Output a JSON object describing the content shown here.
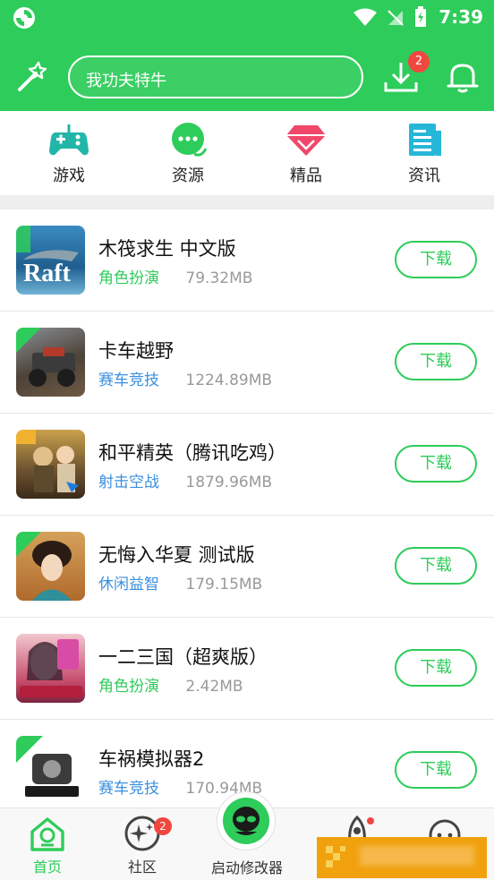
{
  "statusbar": {
    "time": "7:39"
  },
  "header": {
    "search_placeholder": "我功夫特牛",
    "download_badge": "2"
  },
  "categories": [
    {
      "label": "游戏",
      "icon": "gamepad-icon"
    },
    {
      "label": "资源",
      "icon": "chat-bubble-icon"
    },
    {
      "label": "精品",
      "icon": "diamond-icon"
    },
    {
      "label": "资讯",
      "icon": "news-icon"
    }
  ],
  "apps": [
    {
      "name": "木筏求生  中文版",
      "genre": "角色扮演",
      "genre_color": "#2ecc5a",
      "size": "79.32MB",
      "button": "下载"
    },
    {
      "name": "卡车越野",
      "genre": "赛车竞技",
      "genre_color": "#3a8fe0",
      "size": "1224.89MB",
      "button": "下载"
    },
    {
      "name": "和平精英（腾讯吃鸡）",
      "genre": "射击空战",
      "genre_color": "#3a8fe0",
      "size": "1879.96MB",
      "button": "下载"
    },
    {
      "name": "无悔入华夏  测试版",
      "genre": "休闲益智",
      "genre_color": "#3a8fe0",
      "size": "179.15MB",
      "button": "下载"
    },
    {
      "name": "一二三国（超爽版）",
      "genre": "角色扮演",
      "genre_color": "#2ecc5a",
      "size": "2.42MB",
      "button": "下载"
    },
    {
      "name": "车祸模拟器2",
      "genre": "赛车竞技",
      "genre_color": "#3a8fe0",
      "size": "170.94MB",
      "button": "下载"
    }
  ],
  "tabbar": {
    "home": "首页",
    "community": "社区",
    "community_badge": "2",
    "launcher": "启动修改器"
  },
  "colors": {
    "accent": "#2ecc5a",
    "blue": "#3a8fe0",
    "badge": "#f0473f"
  }
}
